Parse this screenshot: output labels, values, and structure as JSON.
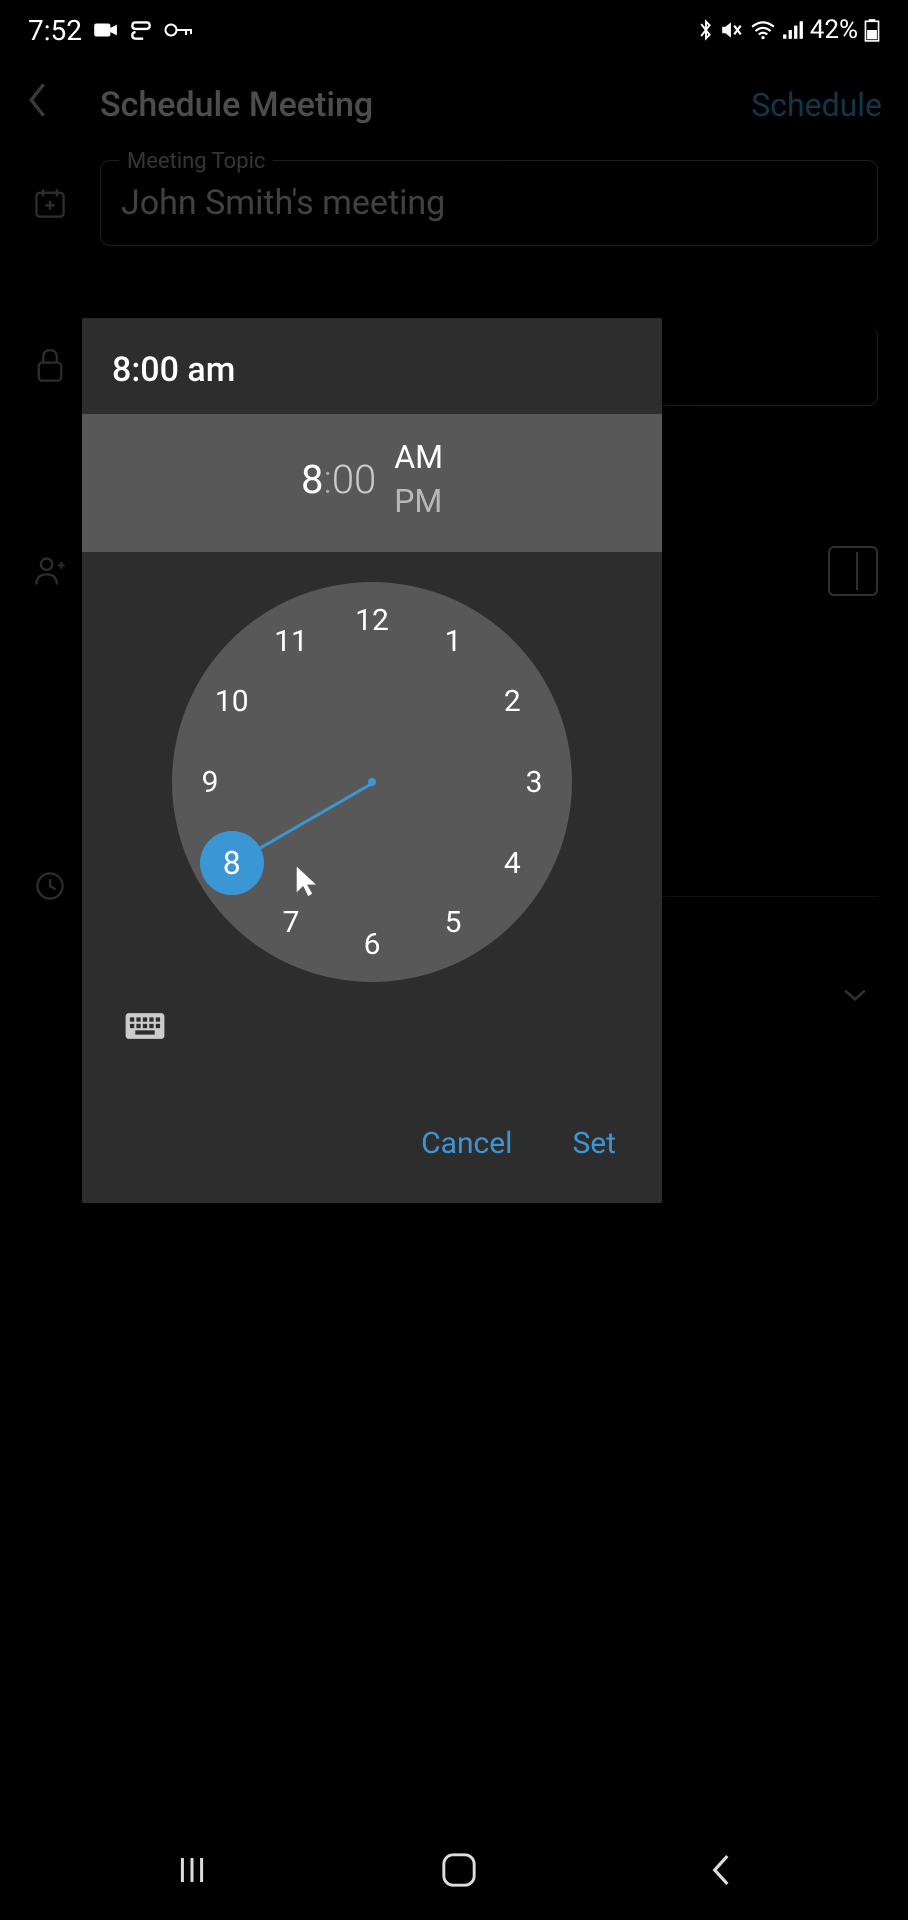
{
  "status_bar": {
    "time": "7:52",
    "battery": "42%"
  },
  "header": {
    "title": "Schedule Meeting",
    "action": "Schedule"
  },
  "form": {
    "topic_label": "Meeting Topic",
    "topic_value": "John Smith's meeting"
  },
  "time_picker": {
    "title": "8:00 am",
    "hour": "8",
    "sep": ":",
    "minute": "00",
    "am": "AM",
    "pm": "PM",
    "selected_hour": 8,
    "numbers": [
      "12",
      "1",
      "2",
      "3",
      "4",
      "5",
      "6",
      "7",
      "8",
      "9",
      "10",
      "11"
    ],
    "cancel": "Cancel",
    "set": "Set"
  }
}
